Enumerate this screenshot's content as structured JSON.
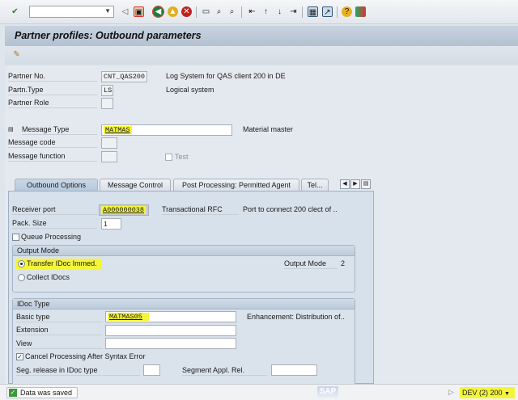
{
  "toolbar": {
    "command_field": "",
    "icons": [
      "enter-icon",
      "save-icon",
      "back-icon",
      "exit-icon",
      "cancel-icon",
      "print-icon",
      "find-icon",
      "find-next-icon",
      "first-page-icon",
      "prev-page-icon",
      "next-page-icon",
      "last-page-icon",
      "new-session-icon",
      "shortcut-icon",
      "help-icon",
      "customize-icon"
    ]
  },
  "title": "Partner profiles: Outbound parameters",
  "header": {
    "partner_no_label": "Partner No.",
    "partner_no": "CNT_QAS200",
    "partner_no_desc": "Log System for QAS client 200 in DE",
    "partn_type_label": "Partn.Type",
    "partn_type": "LS",
    "partn_type_desc": "Logical system",
    "partner_role_label": "Partner Role",
    "partner_role": "",
    "message_type_label": "Message Type",
    "message_type": "MATMAS",
    "message_type_desc": "Material master",
    "message_code_label": "Message code",
    "message_code": "",
    "message_function_label": "Message function",
    "message_function": "",
    "test_label": "Test",
    "test_checked": false
  },
  "tabs": [
    {
      "label": "Outbound Options",
      "active": true
    },
    {
      "label": "Message Control"
    },
    {
      "label": "Post Processing: Permitted Agent"
    },
    {
      "label": "Tel..."
    }
  ],
  "outbound": {
    "receiver_port_label": "Receiver port",
    "receiver_port": "A000000038",
    "port_type": "Transactional RFC",
    "port_desc": "Port to connect 200 clect of ..",
    "pack_size_label": "Pack. Size",
    "pack_size": "1",
    "queue_label": "Queue Processing",
    "queue_checked": false,
    "output_mode": {
      "title": "Output Mode",
      "transfer_label": "Transfer IDoc Immed.",
      "collect_label": "Collect IDocs",
      "selected": "transfer",
      "output_mode_label": "Output Mode",
      "output_mode_value": "2"
    },
    "idoc_type": {
      "title": "IDoc Type",
      "basic_type_label": "Basic type",
      "basic_type": "MATMAS05",
      "basic_type_desc": "Enhancement: Distribution of..",
      "extension_label": "Extension",
      "extension": "",
      "view_label": "View",
      "view": "",
      "cancel_label": "Cancel Processing After Syntax Error",
      "cancel_checked": true,
      "seg_release_label": "Seg. release in IDoc type",
      "seg_release": "",
      "seg_appl_label": "Segment Appl. Rel.",
      "seg_appl": ""
    }
  },
  "status": {
    "message": "Data was saved",
    "logo": "SAP",
    "system": "DEV (2) 200"
  },
  "colors": {
    "highlight": "#f4f53a",
    "title_bar": "#b3c1d0"
  }
}
